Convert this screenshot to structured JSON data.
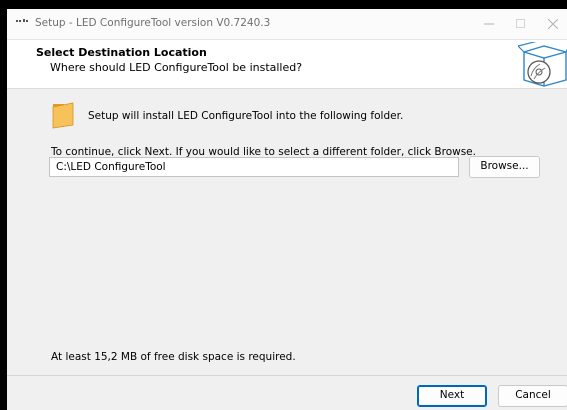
{
  "window": {
    "title": "Setup - LED ConfigureTool version V0.7240.3",
    "controls": {
      "minimize_icon": "minimize-icon",
      "maximize_icon": "maximize-icon",
      "close_icon": "close-icon"
    }
  },
  "header": {
    "title": "Select Destination Location",
    "subtitle": "Where should LED ConfigureTool be installed?",
    "graphic_icon": "installer-box-disc-icon"
  },
  "main": {
    "folder_icon": "folder-icon",
    "intro_text": "Setup will install LED ConfigureTool into the following folder.",
    "continue_text": "To continue, click Next. If you would like to select a different folder, click Browse.",
    "path_value": "C:\\LED ConfigureTool",
    "browse_label": "Browse...",
    "disk_space_text": "At least 15,2 MB of free disk space is required."
  },
  "footer": {
    "next_label": "Next",
    "cancel_label": "Cancel"
  },
  "colors": {
    "accent": "#0067c0",
    "folder": "#f2b146",
    "dialog_bg": "#f0f0f0"
  }
}
